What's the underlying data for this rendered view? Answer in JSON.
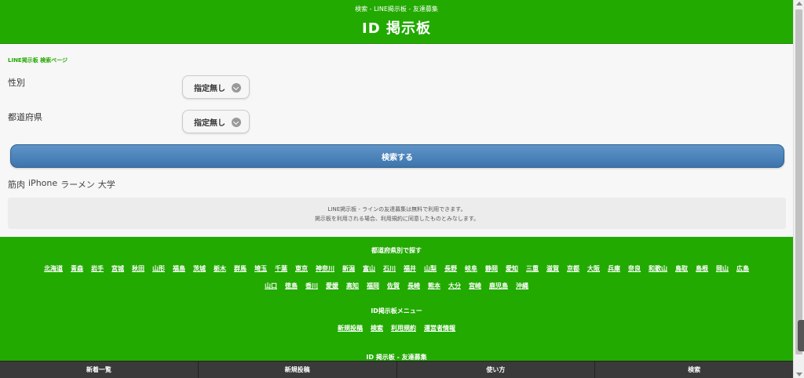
{
  "header": {
    "subtitle": "検索 - LINE掲示板 - 友達募集",
    "title": "ID 掲示板"
  },
  "breadcrumb": "LINE掲示板 検索ページ",
  "form": {
    "gender_label": "性別",
    "gender_value": "指定無し",
    "prefecture_label": "都道府県",
    "prefecture_value": "指定無し",
    "search_button": "検索する"
  },
  "tags": [
    "筋肉",
    "iPhone",
    "ラーメン",
    "大学"
  ],
  "notice": {
    "line1": "LINE掲示板 - ラインの友達募集は無料で利用できます。",
    "line2": "掲示板を利用される場合、利用規約に同意したものとみなします。"
  },
  "footer": {
    "pref_heading": "都道府県別で探す",
    "prefectures_row1": [
      "北海道",
      "青森",
      "岩手",
      "宮城",
      "秋田",
      "山形",
      "福島",
      "茨城",
      "栃木",
      "群馬",
      "埼玉",
      "千葉",
      "東京",
      "神奈川",
      "新潟",
      "富山",
      "石川",
      "福井",
      "山梨",
      "長野",
      "岐阜",
      "静岡",
      "愛知",
      "三重",
      "滋賀",
      "京都",
      "大阪",
      "兵庫",
      "奈良",
      "和歌山",
      "鳥取",
      "島根",
      "岡山",
      "広島"
    ],
    "prefectures_row2": [
      "山口",
      "徳島",
      "香川",
      "愛媛",
      "高知",
      "福岡",
      "佐賀",
      "長崎",
      "熊本",
      "大分",
      "宮崎",
      "鹿児島",
      "沖縄"
    ],
    "menu_heading": "ID掲示板メニュー",
    "menu_items": [
      "新規投稿",
      "検索",
      "利用規約",
      "運営者情報"
    ],
    "site_name": "ID 掲示板 - 友達募集"
  },
  "bottom_nav": [
    "新着一覧",
    "新規投稿",
    "使い方",
    "検索"
  ],
  "colors": {
    "brand_green": "#22aa00",
    "button_blue": "#4a82bb",
    "nav_dark": "#3a3a3a"
  }
}
